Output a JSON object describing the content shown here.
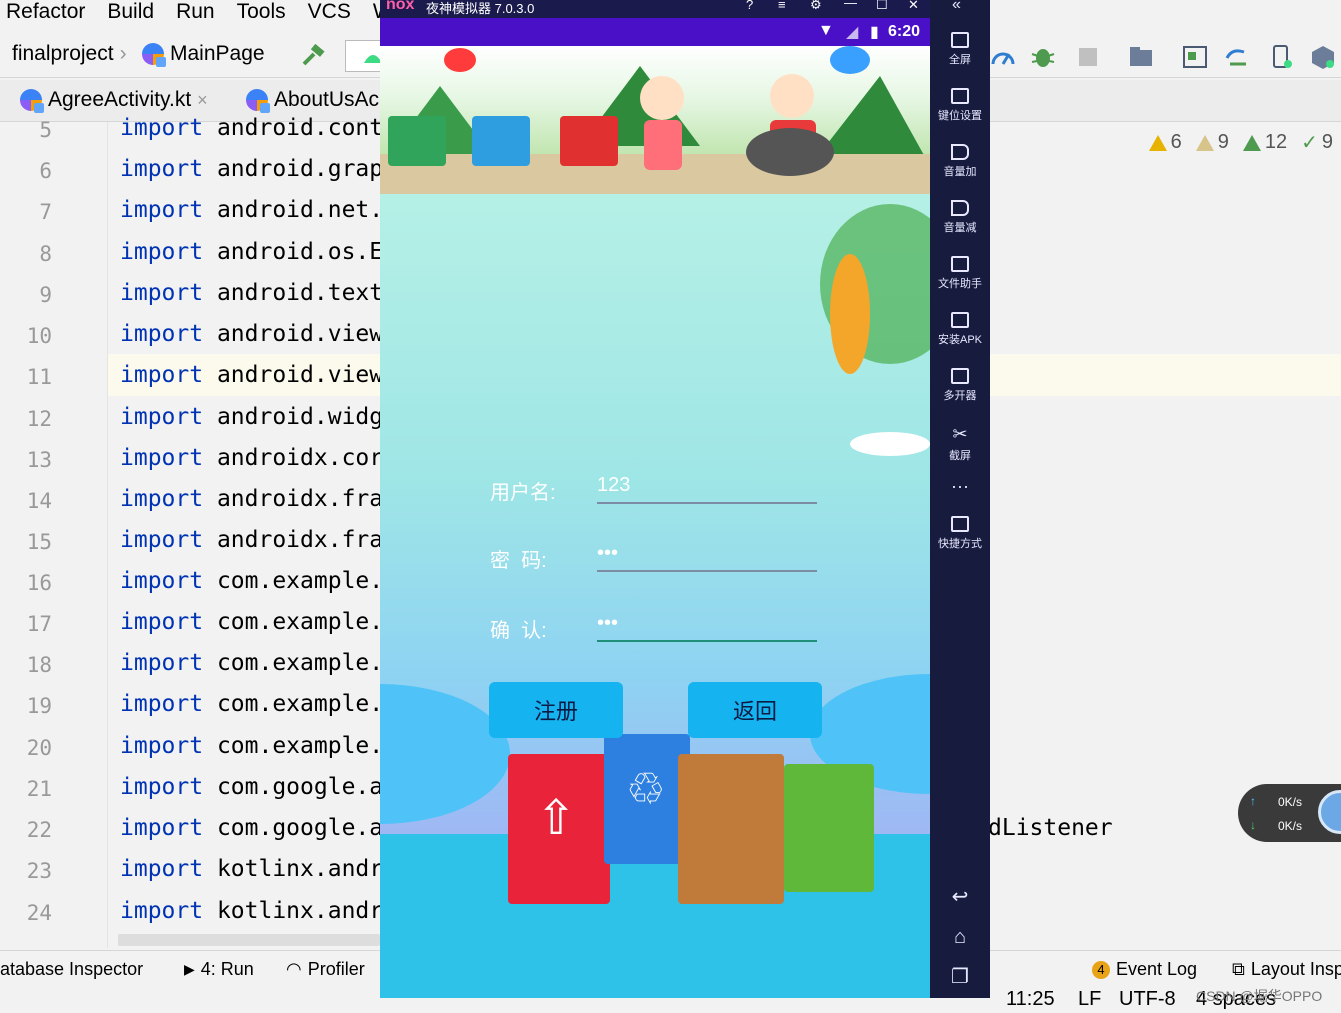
{
  "ide": {
    "menu": [
      "Refactor",
      "Build",
      "Run",
      "Tools",
      "VCS",
      "Wi"
    ],
    "nav": {
      "project": "finalproject",
      "file": "MainPage"
    },
    "tabs": [
      "AgreeActivity.kt",
      "AboutUsAc"
    ],
    "tab_close": "×",
    "code_lines": [
      {
        "num": "5",
        "kw": "import",
        "rest": " android.cont"
      },
      {
        "num": "6",
        "kw": "import",
        "rest": " android.grap"
      },
      {
        "num": "7",
        "kw": "import",
        "rest": " android.net."
      },
      {
        "num": "8",
        "kw": "import",
        "rest": " android.os.E"
      },
      {
        "num": "9",
        "kw": "import",
        "rest": " android.text"
      },
      {
        "num": "10",
        "kw": "import",
        "rest": " android.view"
      },
      {
        "num": "11",
        "kw": "import",
        "rest": " android.view"
      },
      {
        "num": "12",
        "kw": "import",
        "rest": " android.widg"
      },
      {
        "num": "13",
        "kw": "import",
        "rest": " androidx.cor"
      },
      {
        "num": "14",
        "kw": "import",
        "rest": " androidx.fra"
      },
      {
        "num": "15",
        "kw": "import",
        "rest": " androidx.fra"
      },
      {
        "num": "16",
        "kw": "import",
        "rest": " com.example."
      },
      {
        "num": "17",
        "kw": "import",
        "rest": " com.example."
      },
      {
        "num": "18",
        "kw": "import",
        "rest": " com.example."
      },
      {
        "num": "19",
        "kw": "import",
        "rest": " com.example."
      },
      {
        "num": "20",
        "kw": "import",
        "rest": " com.example."
      },
      {
        "num": "21",
        "kw": "import",
        "rest": " com.google.a"
      },
      {
        "num": "22",
        "kw": "import",
        "rest": " com.google.a"
      },
      {
        "num": "23",
        "kw": "import",
        "rest": " kotlinx.andr"
      },
      {
        "num": "24",
        "kw": "import",
        "rest": " kotlinx.andr"
      }
    ],
    "code_overflow": "dListener",
    "inspections": [
      {
        "count": "6",
        "color": "#e8b200"
      },
      {
        "count": "9",
        "color": "#d6c48a"
      },
      {
        "count": "12",
        "color": "#4e9a4e"
      },
      {
        "count": "9",
        "color": "#4e9a4e"
      }
    ],
    "tool_windows": {
      "db": "atabase Inspector",
      "run": "4: Run",
      "profiler": "Profiler",
      "event_badge": "4",
      "event_log": "Event Log",
      "layout": "Layout Insp"
    },
    "status": {
      "pos": "11:25",
      "lf": "LF",
      "enc": "UTF-8",
      "indent": "4 spaces",
      "watermark": "CSDN @堀华OPPO"
    }
  },
  "emulator": {
    "title": "夜神模拟器 7.0.3.0",
    "brand": "nox",
    "time": "6:20",
    "side_buttons": [
      "全屏",
      "键位设置",
      "音量加",
      "音量减",
      "文件助手",
      "安装APK",
      "多开器",
      "截屏",
      "快捷方式"
    ],
    "more": "···",
    "net": {
      "up": "0K/s",
      "down": "0K/s"
    },
    "app": {
      "username_label": "用户名:",
      "username_value": "123",
      "password_label": "密  码:",
      "password_value": "•••",
      "confirm_label": "确  认:",
      "confirm_value": "•••",
      "register_button": "注册",
      "back_button": "返回"
    }
  },
  "colors": {
    "keyword": "#0033b3",
    "phone_status": "#4a10c8",
    "app_button": "#15b3f0",
    "emulator_frame": "#171b3e"
  }
}
